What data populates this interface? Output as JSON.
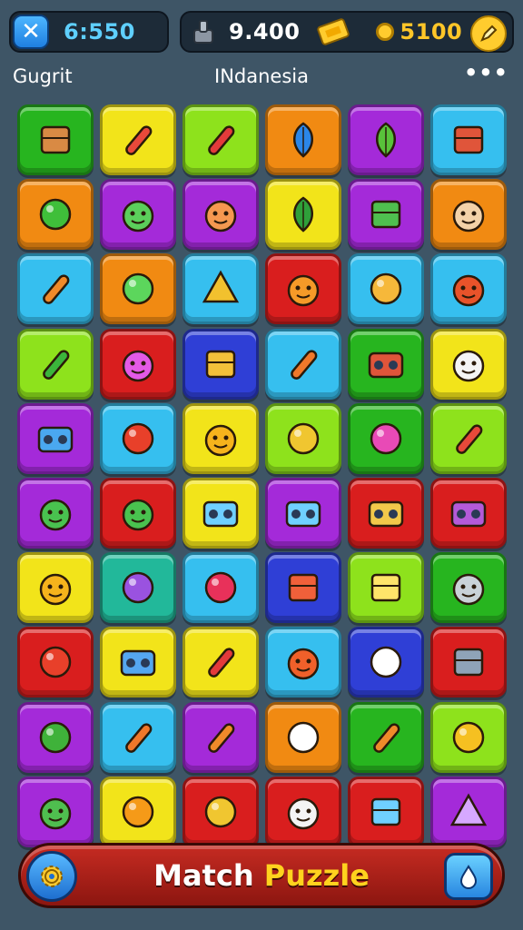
{
  "hud": {
    "timer": "6:550",
    "gems": "9.400",
    "coins": "5100"
  },
  "subheader": {
    "player": "Gugrit",
    "location": "INdanesia",
    "more": "•••"
  },
  "bottom_bar": {
    "title_part1": "Match ",
    "title_part2": "Puzzle"
  },
  "colors": {
    "green": "#27b51f",
    "yellow": "#f2e41a",
    "lime": "#8ee21c",
    "orange": "#f18a12",
    "purple": "#a42ad9",
    "cyan": "#36bfef",
    "red": "#d91e1e",
    "blue": "#2f3fd6",
    "teal": "#22b89a"
  },
  "tiles": [
    [
      "green:box-icon",
      "yellow:rocket-icon",
      "lime:candy-icon",
      "orange:banana-icon",
      "purple:plant-icon",
      "cyan:book-icon"
    ],
    [
      "orange:ball-icon",
      "purple:monster-icon",
      "purple:cat-icon",
      "yellow:leaf-icon",
      "purple:cactus-icon",
      "orange:mouse-icon"
    ],
    [
      "cyan:pencil-icon",
      "orange:drop-icon",
      "cyan:hat-icon",
      "red:fox-icon",
      "cyan:bun-icon",
      "cyan:crab-icon"
    ],
    [
      "lime:pepper-icon",
      "red:bunny-icon",
      "blue:robot-icon",
      "cyan:carrot-icon",
      "green:radio-icon",
      "yellow:ghost-icon"
    ],
    [
      "purple:cassette-icon",
      "cyan:apple-icon",
      "yellow:smiley-icon",
      "lime:beachball-icon",
      "green:lollipop-icon",
      "lime:rocket-icon"
    ],
    [
      "purple:frog-icon",
      "red:frog-icon",
      "yellow:camera-icon",
      "purple:camera-icon",
      "red:panel-icon",
      "red:boombox-icon"
    ],
    [
      "yellow:duck-icon",
      "teal:blob-icon",
      "cyan:cherry-icon",
      "blue:notebook-icon",
      "lime:bucket-icon",
      "green:monkey-icon"
    ],
    [
      "red:apple-icon",
      "yellow:lunchbox-icon",
      "yellow:candy-icon",
      "cyan:starfish-icon",
      "blue:face-icon",
      "red:calculator-icon"
    ],
    [
      "purple:acorn-icon",
      "cyan:carrot-icon",
      "purple:pencil-icon",
      "orange:face-icon",
      "green:pencil-icon",
      "lime:gear-icon"
    ],
    [
      "purple:turtle-icon",
      "yellow:orange-icon",
      "red:beachball-icon",
      "red:ghost-icon",
      "red:tv-icon",
      "purple:bell-icon"
    ]
  ]
}
